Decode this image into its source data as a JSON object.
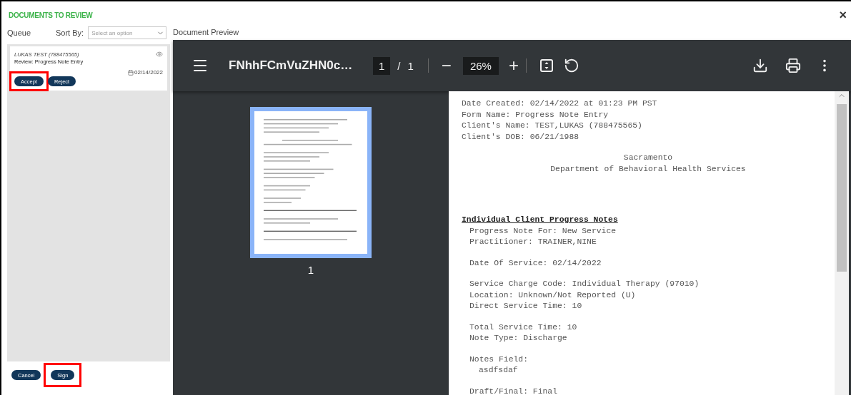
{
  "dialog": {
    "title": "DOCUMENTS TO REVIEW",
    "close": "×"
  },
  "queue": {
    "label": "Queue",
    "sort_label": "Sort By:",
    "sort_placeholder": "Select an option",
    "items": [
      {
        "client": "LUKAS TEST (788475565)",
        "review": "Review: Progress Note Entry",
        "date": "02/14/2022",
        "actions": [
          {
            "label": "Accept",
            "highlighted": true
          },
          {
            "label": "Reject",
            "highlighted": false
          }
        ]
      }
    ]
  },
  "footer_buttons": [
    {
      "label": "Cancel",
      "highlighted": false
    },
    {
      "label": "Sign",
      "highlighted": true
    }
  ],
  "preview": {
    "label": "Document Preview",
    "file_name": "FNhhFCmVuZHN0c…",
    "page": "1",
    "page_sep": "/",
    "page_total": "1",
    "zoom": "26%",
    "minus": "−",
    "plus": "+",
    "thumbnail_number": "1",
    "sections": [
      {
        "kind": "plain",
        "lines": [
          "Date Created: 02/14/2022 at 01:23 PM PST",
          "Form Name: Progress Note Entry",
          "Client's Name: TEST,LUKAS (788475565)",
          "Client's DOB: 06/21/1988"
        ]
      },
      {
        "kind": "center",
        "lines": [
          "Sacramento",
          "Department of Behavioral Health Services"
        ]
      },
      {
        "kind": "heading",
        "lines": [
          "Individual Client Progress Notes"
        ]
      },
      {
        "kind": "indent",
        "lines": [
          "Progress Note For: New Service",
          "Practitioner: TRAINER,NINE"
        ]
      },
      {
        "kind": "indent",
        "lines": [
          "Date Of Service: 02/14/2022"
        ]
      },
      {
        "kind": "indent",
        "lines": [
          "Service Charge Code: Individual Therapy (97010)",
          "Location: Unknown/Not Reported (U)",
          "Direct Service Time: 10"
        ]
      },
      {
        "kind": "indent",
        "lines": [
          "Total Service Time: 10",
          "Note Type: Discharge"
        ]
      },
      {
        "kind": "indent",
        "lines": [
          "Notes Field:"
        ]
      },
      {
        "kind": "indent2",
        "lines": [
          "asdfsdaf"
        ]
      },
      {
        "kind": "indent",
        "lines": [
          "Draft/Final: Final"
        ]
      }
    ]
  }
}
